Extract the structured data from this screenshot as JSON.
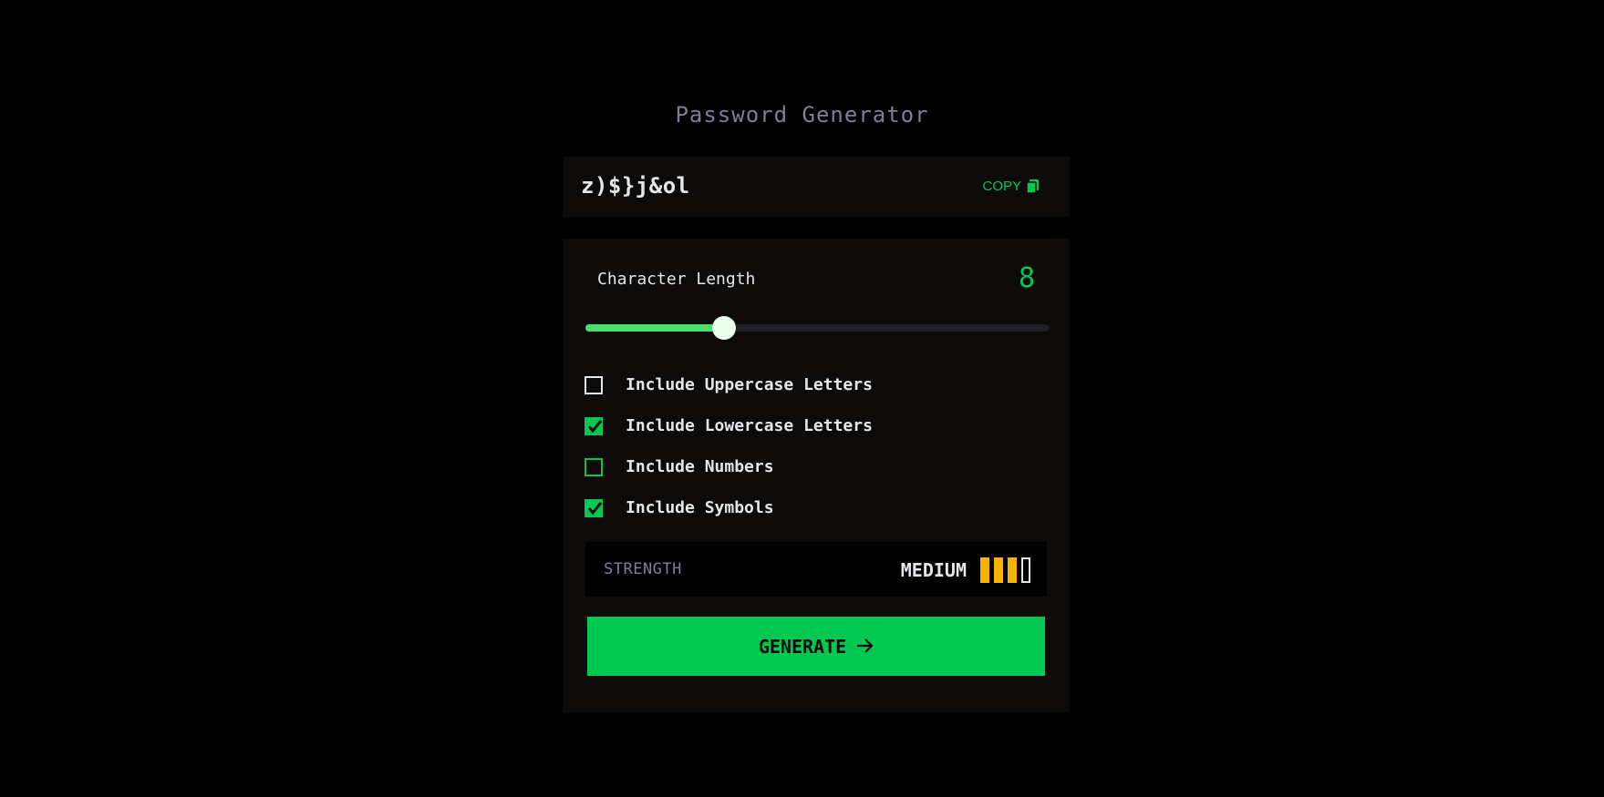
{
  "app": {
    "title": "Password Generator"
  },
  "password": {
    "value": "z)$}j&ol",
    "copy_label": "COPY",
    "copy_icon": "copy-icon"
  },
  "length": {
    "label": "Character Length",
    "value": "8",
    "fraction": 0.3
  },
  "options": [
    {
      "label": "Include Uppercase Letters",
      "checked": false,
      "style": "default"
    },
    {
      "label": "Include Lowercase Letters",
      "checked": true,
      "style": "checked"
    },
    {
      "label": "Include Numbers",
      "checked": false,
      "style": "focused"
    },
    {
      "label": "Include Symbols",
      "checked": true,
      "style": "checked"
    }
  ],
  "strength": {
    "label": "STRENGTH",
    "level_text": "MEDIUM",
    "bars_filled": 3,
    "bars_total": 4
  },
  "generate": {
    "label": "GENERATE",
    "icon": "arrow-right-icon"
  },
  "colors": {
    "accent": "#00c851",
    "bar_fill": "#f8b200",
    "background": "#000000",
    "panel": "#0c0b0a"
  }
}
